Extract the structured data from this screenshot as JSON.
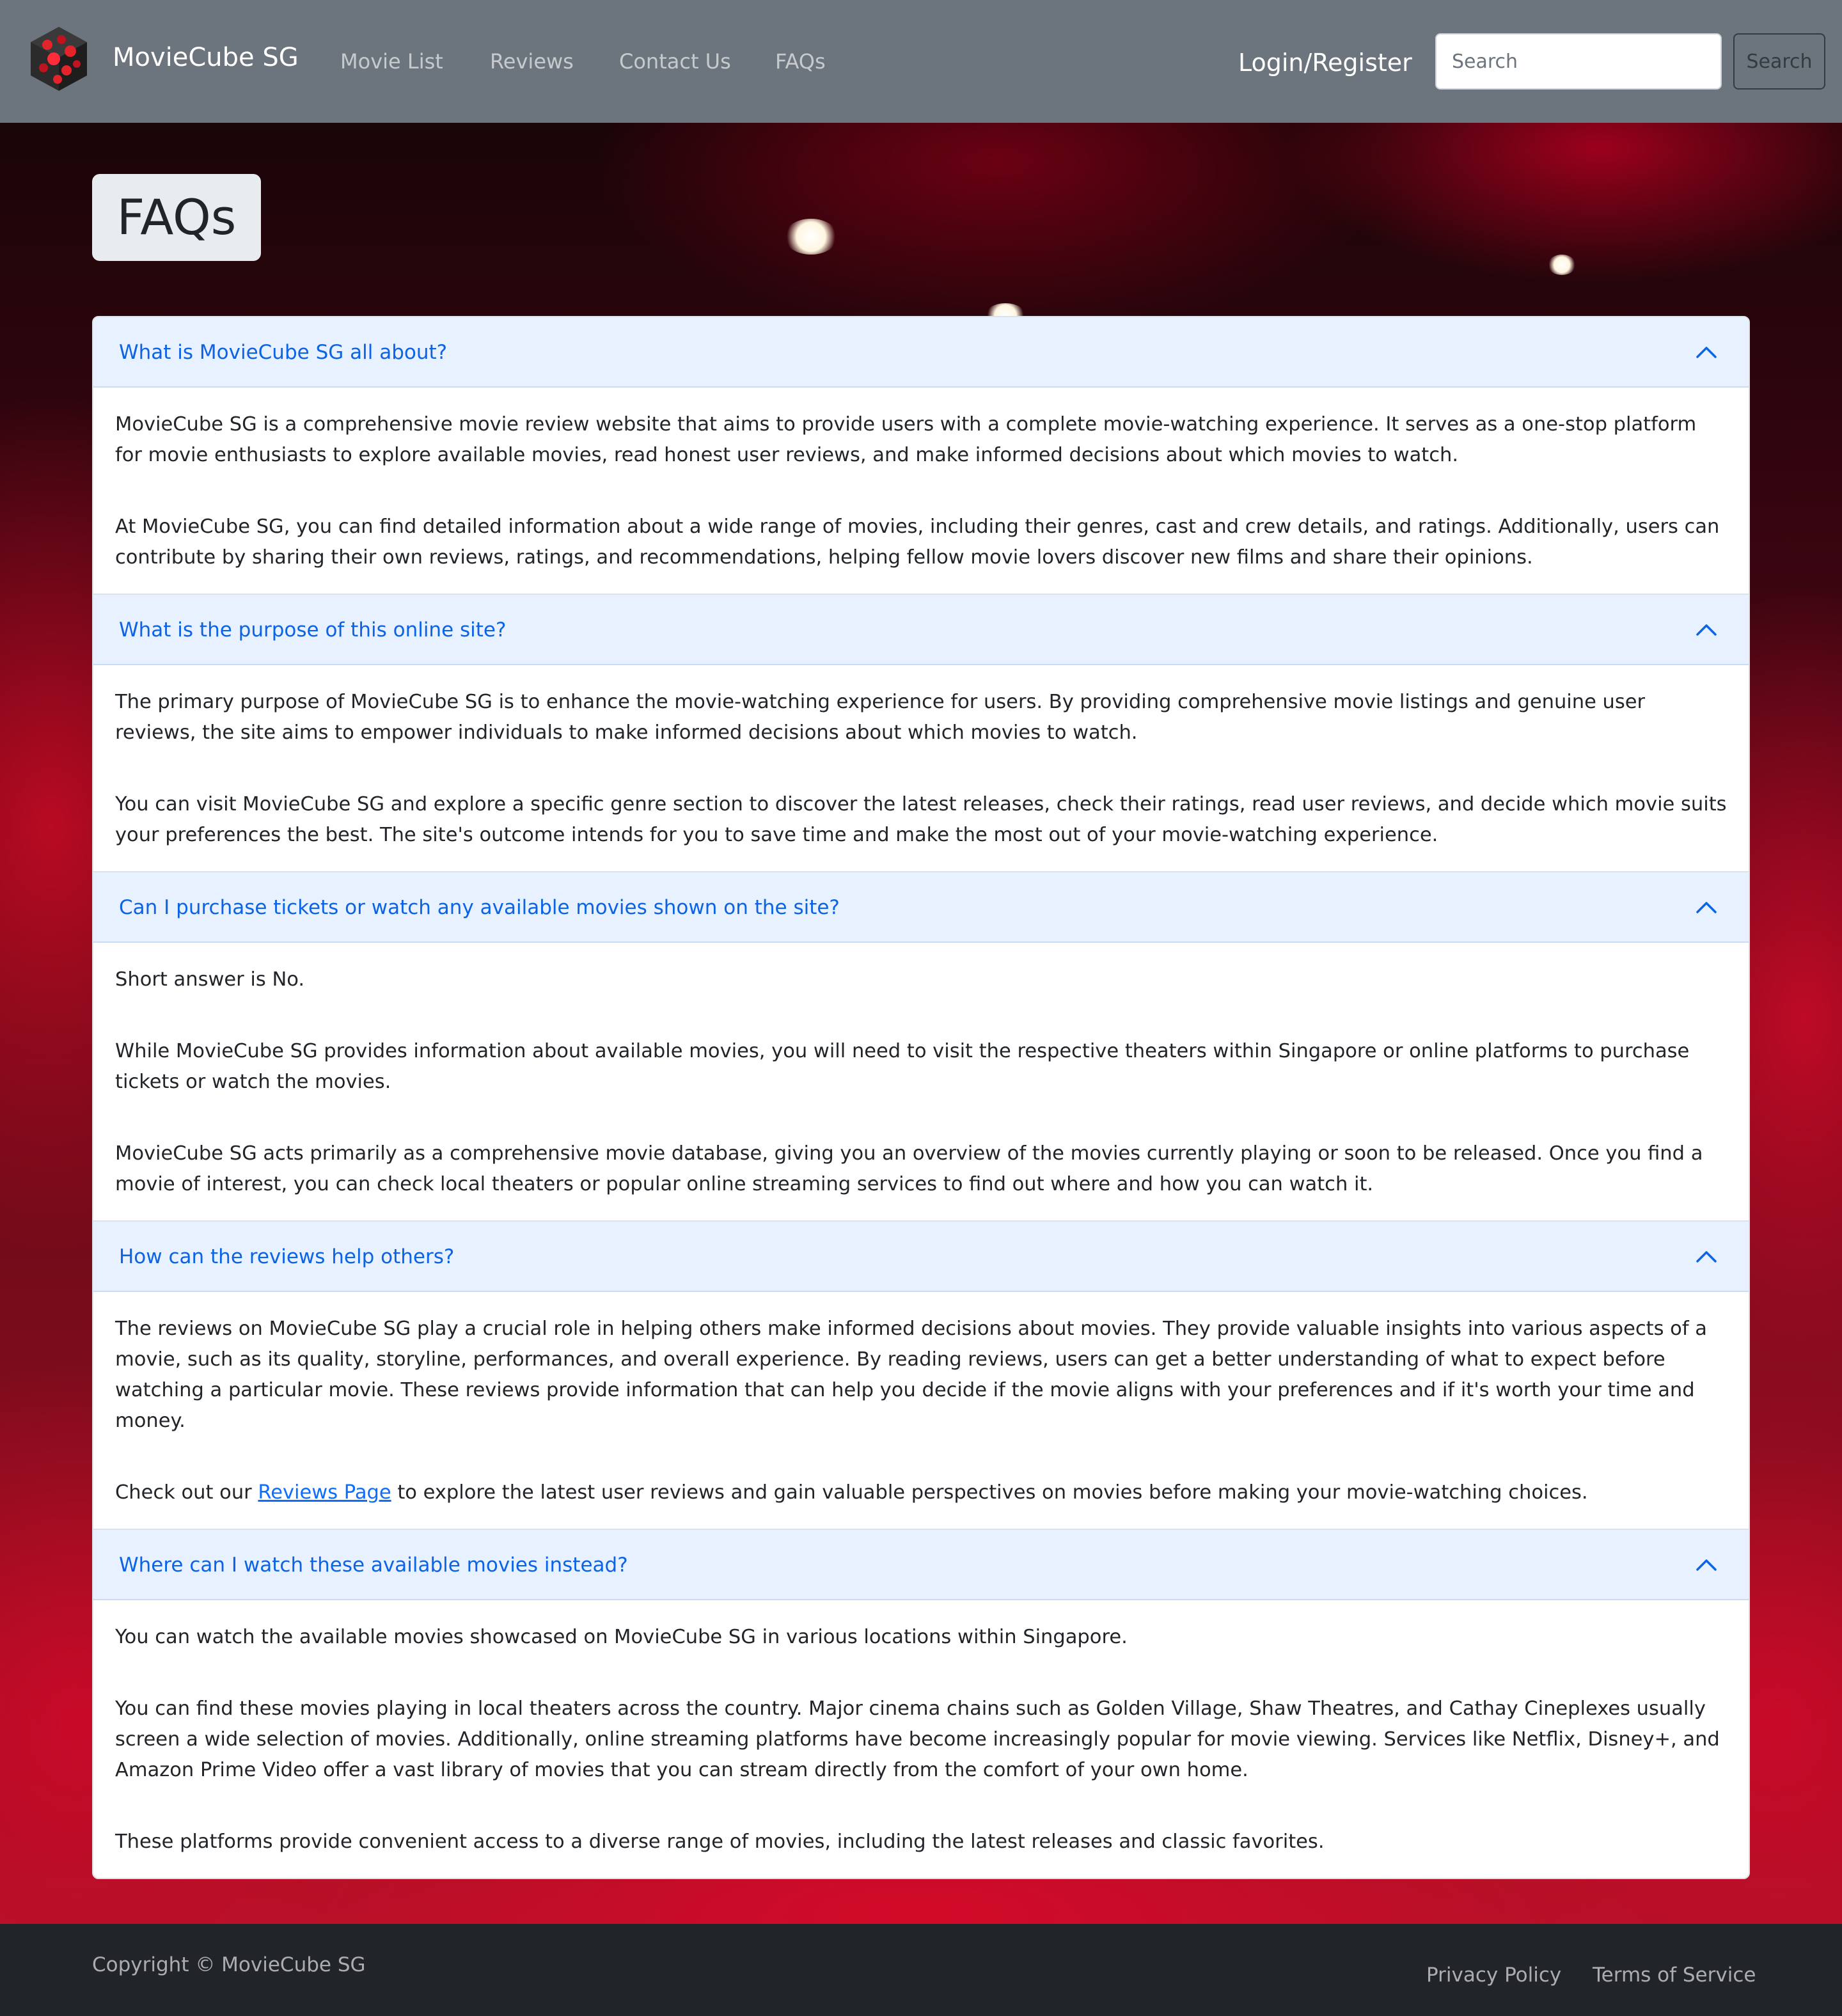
{
  "navbar": {
    "brand": "MovieCube SG",
    "links": [
      "Movie List",
      "Reviews",
      "Contact Us",
      "FAQs"
    ],
    "login": "Login/Register",
    "search_placeholder": "Search",
    "search_button": "Search"
  },
  "page": {
    "title": "FAQs"
  },
  "faqs": [
    {
      "question": "What is MovieCube SG all about?",
      "paragraphs": [
        "MovieCube SG is a comprehensive movie review website that aims to provide users with a complete movie-watching experience. It serves as a one-stop platform for movie enthusiasts to explore available movies, read honest user reviews, and make informed decisions about which movies to watch.",
        "At MovieCube SG, you can find detailed information about a wide range of movies, including their genres, cast and crew details, and ratings. Additionally, users can contribute by sharing their own reviews, ratings, and recommendations, helping fellow movie lovers discover new films and share their opinions."
      ]
    },
    {
      "question": "What is the purpose of this online site?",
      "paragraphs": [
        "The primary purpose of MovieCube SG is to enhance the movie-watching experience for users. By providing comprehensive movie listings and genuine user reviews, the site aims to empower individuals to make informed decisions about which movies to watch.",
        "You can visit MovieCube SG and explore a specific genre section to discover the latest releases, check their ratings, read user reviews, and decide which movie suits your preferences the best. The site's outcome intends for you to save time and make the most out of your movie-watching experience."
      ]
    },
    {
      "question": "Can I purchase tickets or watch any available movies shown on the site?",
      "paragraphs": [
        "Short answer is No.",
        "While MovieCube SG provides information about available movies, you will need to visit the respective theaters within Singapore or online platforms to purchase tickets or watch the movies.",
        "MovieCube SG acts primarily as a comprehensive movie database, giving you an overview of the movies currently playing or soon to be released. Once you find a movie of interest, you can check local theaters or popular online streaming services to find out where and how you can watch it."
      ]
    },
    {
      "question": "How can the reviews help others?",
      "paragraphs": [
        "The reviews on MovieCube SG play a crucial role in helping others make informed decisions about movies. They provide valuable insights into various aspects of a movie, such as its quality, storyline, performances, and overall experience. By reading reviews, users can get a better understanding of what to expect before watching a particular movie. These reviews provide information that can help you decide if the movie aligns with your preferences and if it's worth your time and money."
      ],
      "link_paragraph": {
        "before": "Check out our ",
        "link": "Reviews Page",
        "after": " to explore the latest user reviews and gain valuable perspectives on movies before making your movie-watching choices."
      }
    },
    {
      "question": "Where can I watch these available movies instead?",
      "paragraphs": [
        "You can watch the available movies showcased on MovieCube SG in various locations within Singapore.",
        "You can find these movies playing in local theaters across the country. Major cinema chains such as Golden Village, Shaw Theatres, and Cathay Cineplexes usually screen a wide selection of movies. Additionally, online streaming platforms have become increasingly popular for movie viewing. Services like Netflix, Disney+, and Amazon Prime Video offer a vast library of movies that you can stream directly from the comfort of your own home.",
        "These platforms provide convenient access to a diverse range of movies, including the latest releases and classic favorites."
      ]
    }
  ],
  "footer": {
    "copyright": "Copyright © MovieCube SG",
    "links": [
      "Privacy Policy",
      "Terms of Service"
    ]
  },
  "colors": {
    "navbar_bg": "#6c757d",
    "accordion_header_bg": "#e7f1ff",
    "accordion_question": "#0c63e4",
    "footer_bg": "#212529",
    "link": "#0d6efd"
  },
  "icons": {
    "logo": "cube-logo-icon",
    "chevron": "chevron-up-icon"
  }
}
